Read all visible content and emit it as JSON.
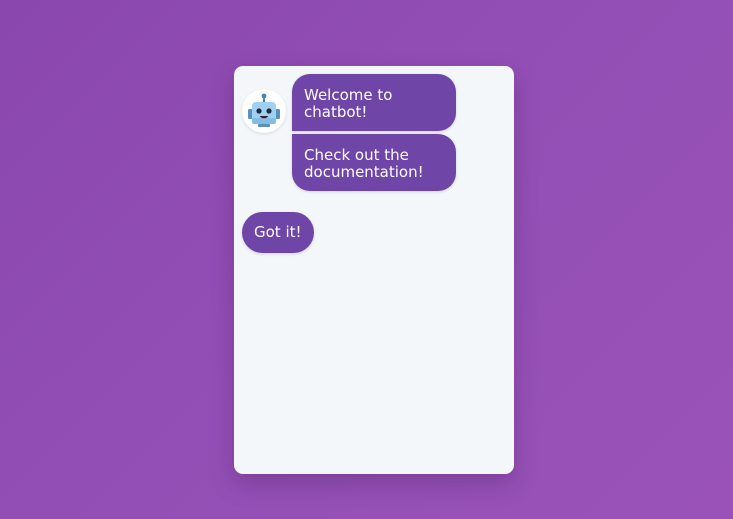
{
  "chat": {
    "bot_avatar_icon": "robot-icon",
    "messages": [
      {
        "sender": "bot",
        "text": "Welcome to chatbot!"
      },
      {
        "sender": "bot",
        "text": "Check out the documentation!"
      },
      {
        "sender": "user",
        "text": "Got it!"
      }
    ]
  },
  "colors": {
    "background_gradient_start": "#8a47ad",
    "background_gradient_end": "#9a52b8",
    "chat_background": "#f4f7fa",
    "bubble": "#6f45a8",
    "bubble_text": "#ffffff",
    "robot_body": "#9fd0f2"
  }
}
